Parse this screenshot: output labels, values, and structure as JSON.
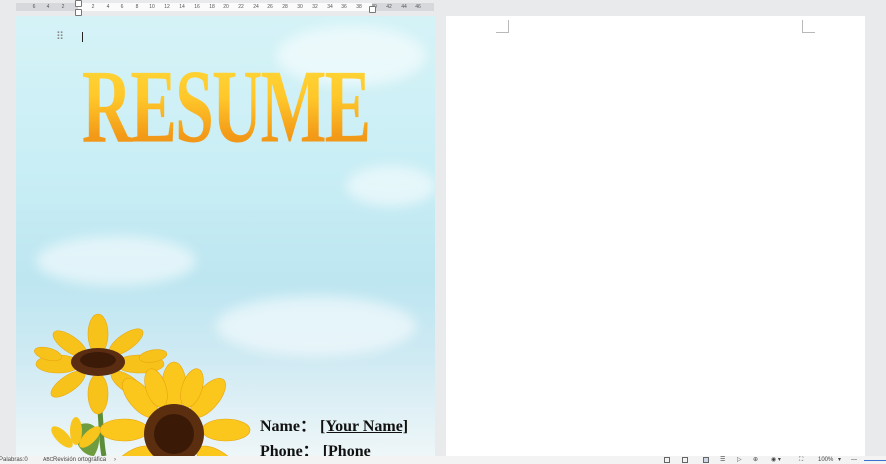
{
  "ruler": {
    "numbers": [
      "6",
      "4",
      "2",
      "2",
      "4",
      "6",
      "8",
      "10",
      "12",
      "14",
      "16",
      "18",
      "20",
      "22",
      "24",
      "26",
      "28",
      "30",
      "32",
      "34",
      "36",
      "38",
      "40",
      "42",
      "44",
      "46"
    ]
  },
  "document": {
    "title": "RESUME",
    "name_label": "Name：",
    "name_value": "[Your Name]",
    "phone_label": "Phone：",
    "phone_value": "[Phone"
  },
  "statusbar": {
    "words": "Palabras:0",
    "spellcheck": "Revisión ortográfica",
    "zoom": "100%"
  },
  "colors": {
    "title_gradient_top": "#ffd93a",
    "title_gradient_bottom": "#ee8d1a",
    "zoom_accent": "#3b6fd1"
  }
}
